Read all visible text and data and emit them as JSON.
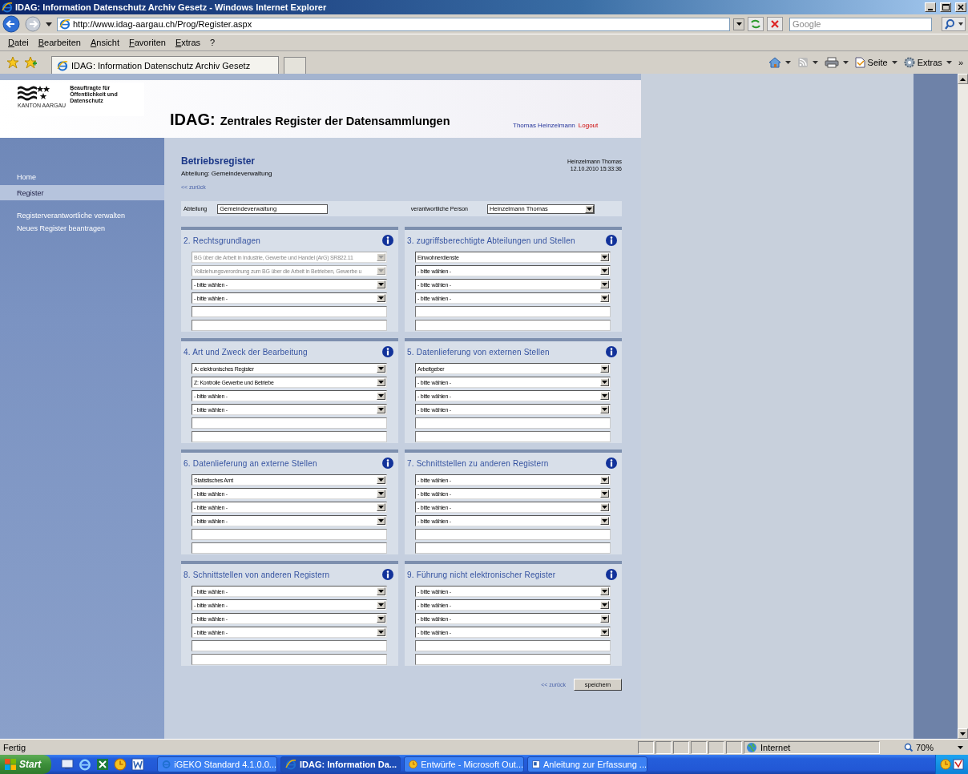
{
  "window": {
    "title": "IDAG: Information Datenschutz Archiv Gesetz - Windows Internet Explorer"
  },
  "address_bar": {
    "url": "http://www.idag-aargau.ch/Prog/Register.aspx"
  },
  "search": {
    "placeholder": "Google"
  },
  "menu": [
    "Datei",
    "Bearbeiten",
    "Ansicht",
    "Favoriten",
    "Extras",
    "?"
  ],
  "tabs": [
    {
      "label": "IDAG: Information Datenschutz Archiv Gesetz",
      "selected": true
    }
  ],
  "command_bar": {
    "items": [
      {
        "kind": "home"
      },
      {
        "kind": "feeds"
      },
      {
        "kind": "print"
      },
      {
        "kind": "page",
        "label": "Seite"
      },
      {
        "kind": "tools",
        "label": "Extras"
      }
    ],
    "overflow": "»"
  },
  "header": {
    "logo": {
      "lines": [
        "Beauftragte für",
        "Öffentlichkeit und",
        "Datenschutz"
      ],
      "canton": "KANTON AARGAU"
    },
    "title_prefix": "IDAG:",
    "title": "Zentrales Register der Datensammlungen",
    "user": "Thomas Heinzelmann",
    "logout": "Logout"
  },
  "sidebar": {
    "items": [
      {
        "label": "Home",
        "selected": false
      },
      {
        "label": "Register",
        "selected": true
      },
      {
        "label": "Registerverantwortliche verwalten",
        "selected": false
      },
      {
        "label": "Neues Register beantragen",
        "selected": false
      }
    ]
  },
  "main": {
    "heading": "Betriebsregister",
    "subheading": "Abteilung: Gemeindeverwaltung",
    "user": "Heinzelmann Thomas",
    "timestamp": "12.10.2010 15:33:36",
    "back_link": "<< zurück",
    "department": {
      "label": "Abteilung",
      "value": "Gemeindeverwaltung"
    },
    "person": {
      "label": "verantwortliche Person",
      "value": "Heinzelmann Thomas"
    }
  },
  "sections": [
    {
      "title": "2. Rechtsgrundlagen",
      "fields": [
        {
          "kind": "select",
          "value": "BG über die Arbeit in Industrie, Gewerbe und Handel (ArG) SR822.11",
          "disabled": true
        },
        {
          "kind": "select",
          "value": "Vollziehungsverordnung zum BG über die Arbeit in Betrieben, Gewerbe u",
          "disabled": true
        },
        {
          "kind": "select",
          "value": "- bitte wählen -",
          "disabled": false
        },
        {
          "kind": "select",
          "value": "- bitte wählen -",
          "disabled": false
        },
        {
          "kind": "text"
        },
        {
          "kind": "text"
        }
      ]
    },
    {
      "title": "3. zugriffsberechtigte Abteilungen und Stellen",
      "fields": [
        {
          "kind": "select",
          "value": "Einwohnerdienste",
          "disabled": false
        },
        {
          "kind": "select",
          "value": "- bitte wählen -",
          "disabled": false
        },
        {
          "kind": "select",
          "value": "- bitte wählen -",
          "disabled": false
        },
        {
          "kind": "select",
          "value": "- bitte wählen -",
          "disabled": false
        },
        {
          "kind": "text"
        },
        {
          "kind": "text"
        }
      ]
    },
    {
      "title": "4. Art und Zweck der Bearbeitung",
      "fields": [
        {
          "kind": "select",
          "value": "A: elektronisches Register",
          "disabled": false
        },
        {
          "kind": "select",
          "value": "Z: Kontrolle Gewerbe und Betriebe",
          "disabled": false
        },
        {
          "kind": "select",
          "value": "- bitte wählen -",
          "disabled": false
        },
        {
          "kind": "select",
          "value": "- bitte wählen -",
          "disabled": false
        },
        {
          "kind": "text"
        },
        {
          "kind": "text"
        }
      ]
    },
    {
      "title": "5. Datenlieferung von externen Stellen",
      "fields": [
        {
          "kind": "select",
          "value": "Arbeitgeber",
          "disabled": false
        },
        {
          "kind": "select",
          "value": "- bitte wählen -",
          "disabled": false
        },
        {
          "kind": "select",
          "value": "- bitte wählen -",
          "disabled": false
        },
        {
          "kind": "select",
          "value": "- bitte wählen -",
          "disabled": false
        },
        {
          "kind": "text"
        },
        {
          "kind": "text"
        }
      ]
    },
    {
      "title": "6. Datenlieferung an externe Stellen",
      "fields": [
        {
          "kind": "select",
          "value": "Statistisches Amt",
          "disabled": false
        },
        {
          "kind": "select",
          "value": "- bitte wählen -",
          "disabled": false
        },
        {
          "kind": "select",
          "value": "- bitte wählen -",
          "disabled": false
        },
        {
          "kind": "select",
          "value": "- bitte wählen -",
          "disabled": false
        },
        {
          "kind": "text"
        },
        {
          "kind": "text"
        }
      ]
    },
    {
      "title": "7. Schnittstellen zu anderen Registern",
      "fields": [
        {
          "kind": "select",
          "value": "- bitte wählen -",
          "disabled": false
        },
        {
          "kind": "select",
          "value": "- bitte wählen -",
          "disabled": false
        },
        {
          "kind": "select",
          "value": "- bitte wählen -",
          "disabled": false
        },
        {
          "kind": "select",
          "value": "- bitte wählen -",
          "disabled": false
        },
        {
          "kind": "text"
        },
        {
          "kind": "text"
        }
      ]
    },
    {
      "title": "8. Schnittstellen von anderen Registern",
      "fields": [
        {
          "kind": "select",
          "value": "- bitte wählen -",
          "disabled": false
        },
        {
          "kind": "select",
          "value": "- bitte wählen -",
          "disabled": false
        },
        {
          "kind": "select",
          "value": "- bitte wählen -",
          "disabled": false
        },
        {
          "kind": "select",
          "value": "- bitte wählen -",
          "disabled": false
        },
        {
          "kind": "text"
        },
        {
          "kind": "text"
        }
      ]
    },
    {
      "title": "9. Führung nicht elektronischer Register",
      "fields": [
        {
          "kind": "select",
          "value": "- bitte wählen -",
          "disabled": false
        },
        {
          "kind": "select",
          "value": "- bitte wählen -",
          "disabled": false
        },
        {
          "kind": "select",
          "value": "- bitte wählen -",
          "disabled": false
        },
        {
          "kind": "select",
          "value": "- bitte wählen -",
          "disabled": false
        },
        {
          "kind": "text"
        },
        {
          "kind": "text"
        }
      ]
    }
  ],
  "footer": {
    "back_link": "<< zurück",
    "save": "speichern"
  },
  "status_bar": {
    "text": "Fertig",
    "zone": "Internet",
    "zoom": "70%"
  },
  "taskbar": {
    "start": "Start",
    "tasks": [
      {
        "label": "iGEKO Standard 4.1.0.0...",
        "selected": false
      },
      {
        "label": "IDAG: Information Da...",
        "selected": true
      },
      {
        "label": "Entwürfe - Microsoft Out...",
        "selected": false
      },
      {
        "label": "Anleitung zur Erfassung ...",
        "selected": false
      }
    ]
  }
}
